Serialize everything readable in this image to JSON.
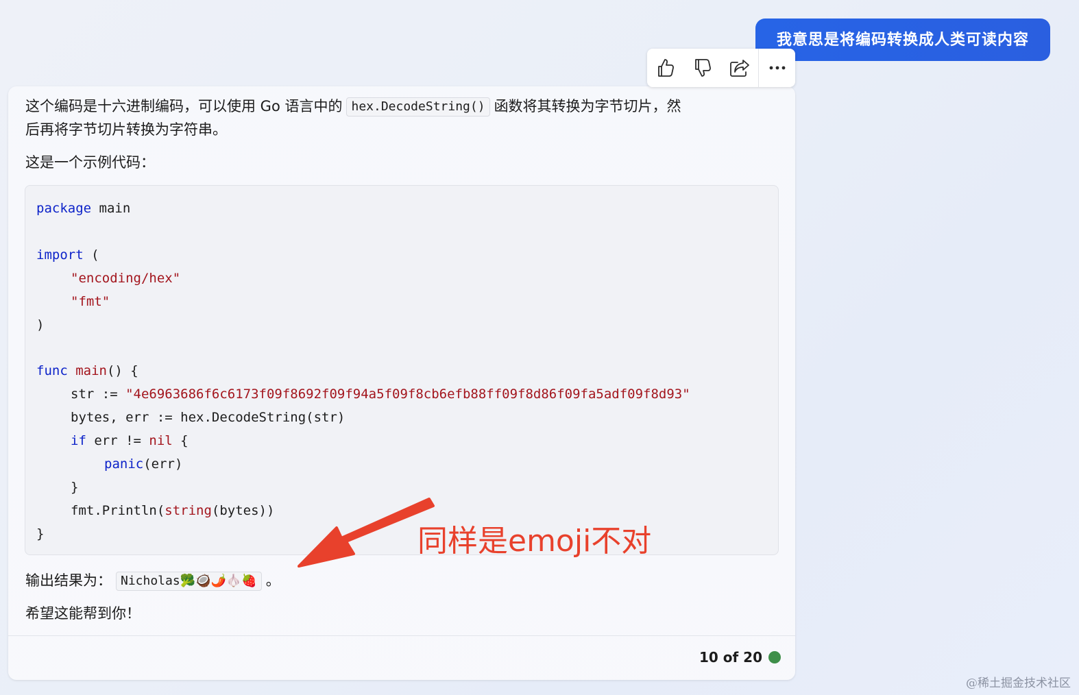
{
  "user_message": "我意思是将编码转换成人类可读内容",
  "reactions": {
    "like_icon": "thumbs-up-icon",
    "dislike_icon": "thumbs-down-icon",
    "share_icon": "share-icon",
    "more_icon": "more-icon"
  },
  "response": {
    "intro_part1": "这个编码是十六进制编码，可以使用 Go 语言中的",
    "intro_code": "hex.DecodeString()",
    "intro_part2": "函数将其转换为字节切片，然",
    "intro_line2": "后再将字节切片转换为字符串。",
    "example_label": "这是一个示例代码：",
    "code": {
      "l1_kw": "package",
      "l1_rest": " main",
      "l2_kw": "import",
      "l2_rest": " (",
      "l3_str": "\"encoding/hex\"",
      "l4_str": "\"fmt\"",
      "l5": ")",
      "l6_kw": "func",
      "l6_fn": "main",
      "l6_rest": "() {",
      "l7_pre": "str := ",
      "l7_str": "\"4e6963686f6c6173f09f8692f09f94a5f09f8cb6efb88ff09f8d86f09fa5adf09f8d93\"",
      "l8": "bytes, err := hex.DecodeString(str)",
      "l9_kw": "if",
      "l9_mid": " err != ",
      "l9_nil": "nil",
      "l9_rest": " {",
      "l10_fn": "panic",
      "l10_rest": "(err)",
      "l11": "}",
      "l12_pre": "fmt.Println(",
      "l12_fn": "string",
      "l12_rest": "(bytes))",
      "l13": "}"
    },
    "output_label": "输出结果为：",
    "output_code": "Nicholas🥦🥥🌶️🧄🍓",
    "output_end": "。",
    "closing": "希望这能帮到你！",
    "counter": "10 of 20",
    "status_color": "#3f8f4a"
  },
  "annotation": {
    "text": "同样是emoji不对",
    "color": "#e8412c"
  },
  "watermark": "@稀土掘金技术社区"
}
